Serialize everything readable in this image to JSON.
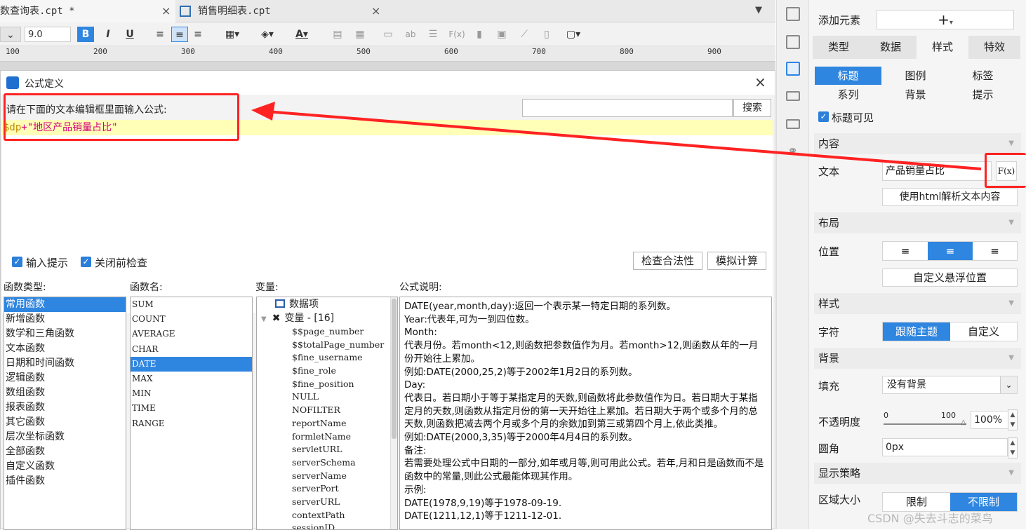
{
  "tabs": [
    {
      "label": "数查询表.cpt *",
      "close": "×"
    },
    {
      "label": "销售明细表.cpt",
      "close": "×"
    }
  ],
  "toolbar": {
    "font_size": "9.0",
    "bold": "B",
    "italic": "I",
    "underline": "U",
    "font_color": "A"
  },
  "ruler": [
    "100",
    "200",
    "300",
    "400",
    "500",
    "600",
    "700",
    "800",
    "900"
  ],
  "dialog": {
    "title": "公式定义",
    "close": "×",
    "prompt": "请在下面的文本编辑框里面输入公式:",
    "search_placeholder": "",
    "search_button": "搜索",
    "formula_var": "$dp",
    "formula_rest": "+\"地区产品销量占比\"",
    "check_input_hint": "输入提示",
    "check_before_close": "关闭前检查",
    "validate_button": "检查合法性",
    "simulate_button": "模拟计算",
    "col_function_type": "函数类型:",
    "col_function_name": "函数名:",
    "col_variable": "变量:",
    "col_description": "公式说明:",
    "function_types": [
      "常用函数",
      "新增函数",
      "数学和三角函数",
      "文本函数",
      "日期和时间函数",
      "逻辑函数",
      "数组函数",
      "报表函数",
      "其它函数",
      "层次坐标函数",
      "全部函数",
      "自定义函数",
      "插件函数"
    ],
    "function_types_selected": 0,
    "function_names": [
      "SUM",
      "COUNT",
      "AVERAGE",
      "CHAR",
      "DATE",
      "MAX",
      "MIN",
      "TIME",
      "RANGE"
    ],
    "function_names_selected": 4,
    "variable_group_data": "数据项",
    "variable_group_vars": "变量 - [16]",
    "variables": [
      "$$page_number",
      "$$totalPage_number",
      "$fine_username",
      "$fine_role",
      "$fine_position",
      "NULL",
      "NOFILTER",
      "reportName",
      "formletName",
      "servletURL",
      "serverSchema",
      "serverName",
      "serverPort",
      "serverURL",
      "contextPath",
      "sessionID"
    ],
    "description": [
      "DATE(year,month,day):返回一个表示某一特定日期的系列数。",
      "Year:代表年,可为一到四位数。",
      "Month:",
      "代表月份。若month<12,则函数把参数值作为月。若month>12,则函数从年的一月份开始往上累加。",
      "例如:DATE(2000,25,2)等于2002年1月2日的系列数。",
      "Day:",
      "代表日。若日期小于等于某指定月的天数,则函数将此参数值作为日。若日期大于某指定月的天数,则函数从指定月份的第一天开始往上累加。若日期大于两个或多个月的总天数,则函数把减去两个月或多个月的余数加到第三或第四个月上,依此类推。",
      "例如:DATE(2000,3,35)等于2000年4月4日的系列数。",
      "备注:",
      "若需要处理公式中日期的一部分,如年或月等,则可用此公式。若年,月和日是函数而不是函数中的常量,则此公式最能体现其作用。",
      "示例:",
      "DATE(1978,9,19)等于1978-09-19.",
      "DATE(1211,12,1)等于1211-12-01."
    ]
  },
  "panel": {
    "add_element_label": "添加元素",
    "add_element_btn": "+",
    "main_tabs": [
      "类型",
      "数据",
      "样式",
      "特效"
    ],
    "main_tab_selected": 2,
    "sub_tabs": [
      "标题",
      "图例",
      "标签",
      "系列",
      "背景",
      "提示"
    ],
    "sub_tab_selected": 0,
    "title_visible": "标题可见",
    "sec_content": "内容",
    "text_label": "文本",
    "text_value": "产品销量占比",
    "fx_button": "F(x)",
    "html_button": "使用html解析文本内容",
    "sec_layout": "布局",
    "position_label": "位置",
    "custom_float": "自定义悬浮位置",
    "sec_style": "样式",
    "char_label": "字符",
    "follow_theme": "跟随主题",
    "custom": "自定义",
    "sec_background": "背景",
    "fill_label": "填充",
    "fill_value": "没有背景",
    "opacity_label": "不透明度",
    "slider_min": "0",
    "slider_max": "100",
    "opacity_value": "100%",
    "radius_label": "圆角",
    "radius_value": "0px",
    "sec_display": "显示策略",
    "area_label": "区域大小",
    "limit": "限制",
    "no_limit": "不限制"
  },
  "watermark": "CSDN @失去斗志的菜鸟",
  "colors": {
    "accent": "#2f86e0",
    "annotation": "#ff2222",
    "formula_bg": "#ffffb8"
  }
}
